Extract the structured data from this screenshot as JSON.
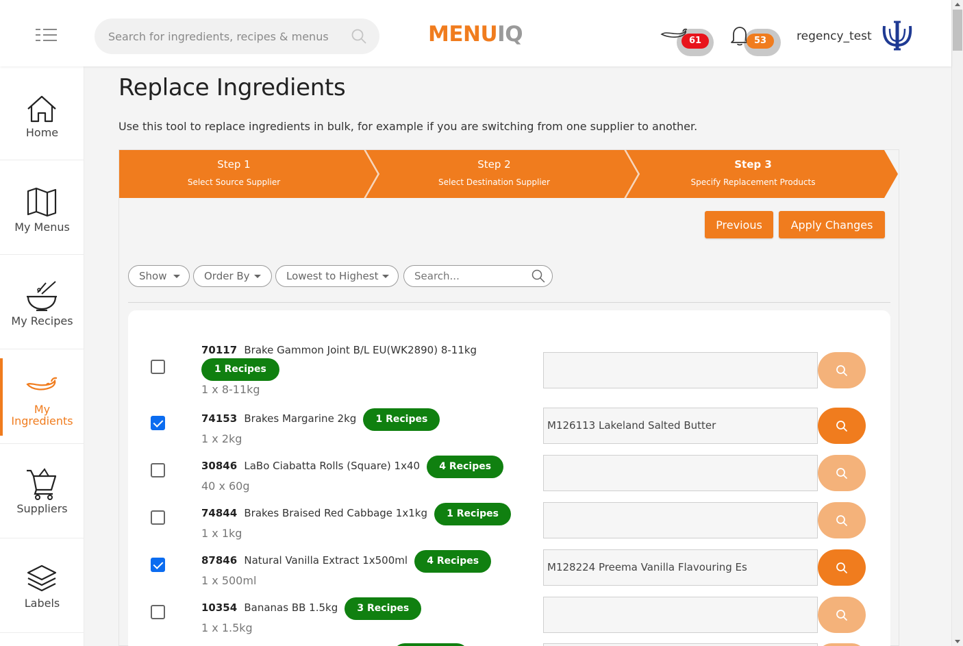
{
  "header": {
    "search_placeholder": "Search for ingredients, recipes & menus",
    "logo_part1": "MENU",
    "logo_part2": "IQ",
    "chilli_count": "61",
    "bell_count": "53",
    "username": "regency_test"
  },
  "sidebar": {
    "items": [
      {
        "label": "Home",
        "icon": "home-icon"
      },
      {
        "label": "My Menus",
        "icon": "map-icon"
      },
      {
        "label": "My Recipes",
        "icon": "bowl-icon"
      },
      {
        "label": "My Ingredients",
        "icon": "chilli-icon",
        "line1": "My",
        "line2": "Ingredients"
      },
      {
        "label": "Suppliers",
        "icon": "cart-icon"
      },
      {
        "label": "Labels",
        "icon": "layers-icon"
      }
    ]
  },
  "page": {
    "title": "Replace Ingredients",
    "description": "Use this tool to replace ingredients in bulk, for example if you are switching from one supplier to another."
  },
  "steps": [
    {
      "title": "Step 1",
      "subtitle": "Select Source Supplier"
    },
    {
      "title": "Step 2",
      "subtitle": "Select Destination Supplier"
    },
    {
      "title": "Step 3",
      "subtitle": "Specify Replacement Products"
    }
  ],
  "actions": {
    "previous": "Previous",
    "apply": "Apply Changes"
  },
  "filters": {
    "show": "Show",
    "order_by": "Order By",
    "sort": "Lowest to Highest",
    "search_placeholder": "Search..."
  },
  "rows": [
    {
      "code": "70117",
      "name": "Brake Gammon Joint B/L EU(WK2890) 8-11kg",
      "recipes": "1 Recipes",
      "pack": "1 x 8-11kg",
      "checked": false,
      "replacement": ""
    },
    {
      "code": "74153",
      "name": "Brakes Margarine 2kg",
      "recipes": "1 Recipes",
      "pack": "1 x 2kg",
      "checked": true,
      "replacement": "M126113 Lakeland Salted Butter"
    },
    {
      "code": "30846",
      "name": "LaBo Ciabatta Rolls (Square) 1x40",
      "recipes": "4 Recipes",
      "pack": "40 x 60g",
      "checked": false,
      "replacement": ""
    },
    {
      "code": "74844",
      "name": "Brakes Braised Red Cabbage 1x1kg",
      "recipes": "1 Recipes",
      "pack": "1 x 1kg",
      "checked": false,
      "replacement": ""
    },
    {
      "code": "87846",
      "name": "Natural Vanilla Extract 1x500ml",
      "recipes": "4 Recipes",
      "pack": "1 x 500ml",
      "checked": true,
      "replacement": "M128224 Preema Vanilla Flavouring Es"
    },
    {
      "code": "10354",
      "name": "Bananas BB 1.5kg",
      "recipes": "3 Recipes",
      "pack": "1 x 1.5kg",
      "checked": false,
      "replacement": ""
    }
  ],
  "colors": {
    "accent": "#f07c1e",
    "accent_light": "#f4b27a",
    "recipe_badge": "#108010",
    "checkbox": "#0b6cf0"
  }
}
